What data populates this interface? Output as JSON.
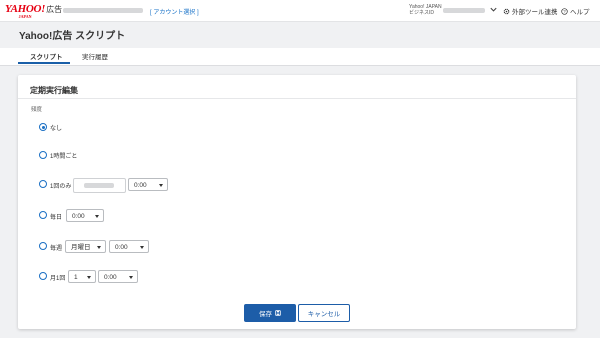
{
  "header": {
    "logo_main": "YAHOO!",
    "logo_sub": "JAPAN",
    "logo_suffix": "広告",
    "account_select": "[ アカウント選択 ]",
    "biz_id_line1": "Yahoo! JAPAN",
    "biz_id_line2": "ビジネスID",
    "external_tools": "外部ツール連携",
    "help": "ヘルプ"
  },
  "page": {
    "title": "Yahoo!広告 スクリプト",
    "tabs": [
      {
        "label": "スクリプト",
        "active": true
      },
      {
        "label": "実行履歴",
        "active": false
      }
    ]
  },
  "card": {
    "title": "定期実行編集",
    "frequency_label": "頻度",
    "options": [
      {
        "label": "なし",
        "checked": true
      },
      {
        "label": "1時間ごと",
        "checked": false
      },
      {
        "label": "1回のみ",
        "checked": false,
        "time": "0:00"
      },
      {
        "label": "毎日",
        "checked": false,
        "time": "0:00"
      },
      {
        "label": "毎週",
        "checked": false,
        "weekday": "月曜日",
        "time": "0:00"
      },
      {
        "label": "月1回",
        "checked": false,
        "day": "1",
        "time": "0:00"
      }
    ],
    "save_label": "保存",
    "cancel_label": "キャンセル"
  },
  "colors": {
    "accent": "#1d5da8",
    "brand": "#e60012",
    "background": "#f0f1f3"
  },
  "icons": [
    "chevron-down-icon",
    "gear-icon",
    "help-circle-icon",
    "save-icon",
    "dropdown-arrow-icon"
  ]
}
